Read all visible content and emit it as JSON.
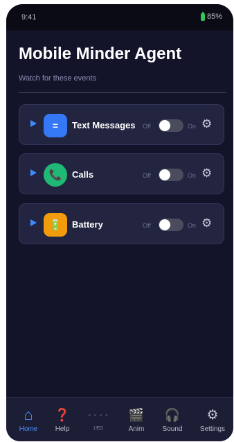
{
  "status": {
    "time": "9:41",
    "battery": "85%"
  },
  "header": {
    "title": "Mobile Minder Agent",
    "subtitle": "Watch for these events"
  },
  "events": [
    {
      "label": "Text Messages",
      "off": "Off",
      "on": "On",
      "enabled": false,
      "icon": "message-icon",
      "icon_glyph": "=",
      "color": "#3478f6"
    },
    {
      "label": "Calls",
      "off": "Off",
      "on": "On",
      "enabled": false,
      "icon": "phone-icon",
      "icon_glyph": "📞",
      "color": "#1fb874"
    },
    {
      "label": "Battery",
      "off": "Off",
      "on": "On",
      "enabled": false,
      "icon": "battery-icon",
      "icon_glyph": "🔋",
      "color": "#f29b0c"
    }
  ],
  "nav": [
    {
      "label": "Home",
      "icon": "home-icon",
      "glyph": "⌂",
      "active": true
    },
    {
      "label": "Help",
      "icon": "help-icon",
      "glyph": "❓",
      "active": false
    },
    {
      "label": "LED",
      "icon": "led-icon",
      "glyph": "- - - -",
      "active": false
    },
    {
      "label": "Anim",
      "icon": "clapperboard-icon",
      "glyph": "🎬",
      "active": false
    },
    {
      "label": "Sound",
      "icon": "headphones-icon",
      "glyph": "🎧",
      "active": false
    },
    {
      "label": "Settings",
      "icon": "gear-icon",
      "glyph": "⚙",
      "active": false
    }
  ],
  "colors": {
    "accent": "#3d8bff",
    "background": "#13142a",
    "card": "#232540",
    "battery_green": "#34c759"
  }
}
